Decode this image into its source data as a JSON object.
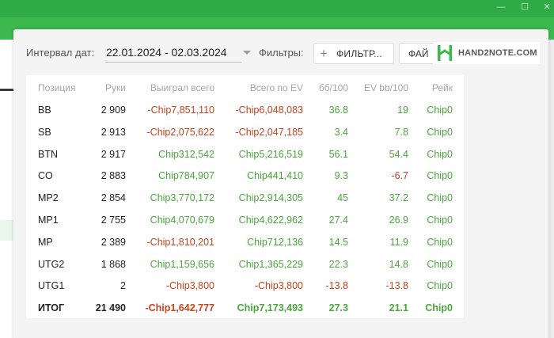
{
  "toolbar": {
    "date_label": "Интервал дат:",
    "date_range": "22.01.2024 - 02.03.2024",
    "filters_label": "Фильтры:",
    "filter_button": "ФИЛЬТР...",
    "file_button": "ФАЙ",
    "brand": "HAND2NOTE.COM"
  },
  "colors": {
    "positive": "#4aa63b",
    "negative": "#c5431e",
    "header_green": "#3cb84f"
  },
  "table": {
    "headers": [
      "Позиция",
      "Руки",
      "Выиграл всего",
      "Всего по EV",
      "бб/100",
      "EV bb/100",
      "Рейк"
    ],
    "rows": [
      {
        "pos": "BB",
        "hands": "2 909",
        "won": "-Chip7,851,110",
        "ev": "-Chip6,048,083",
        "bb": "36.8",
        "evbb": "19",
        "rake": "Chip0"
      },
      {
        "pos": "SB",
        "hands": "2 913",
        "won": "-Chip2,075,622",
        "ev": "-Chip2,047,185",
        "bb": "3.4",
        "evbb": "7.8",
        "rake": "Chip0"
      },
      {
        "pos": "BTN",
        "hands": "2 917",
        "won": "Chip312,542",
        "ev": "Chip5,216,519",
        "bb": "56.1",
        "evbb": "54.4",
        "rake": "Chip0"
      },
      {
        "pos": "CO",
        "hands": "2 883",
        "won": "Chip784,907",
        "ev": "Chip441,410",
        "bb": "9.3",
        "evbb": "-6.7",
        "rake": "Chip0"
      },
      {
        "pos": "MP2",
        "hands": "2 854",
        "won": "Chip3,770,172",
        "ev": "Chip2,914,305",
        "bb": "45",
        "evbb": "37.2",
        "rake": "Chip0"
      },
      {
        "pos": "MP1",
        "hands": "2 755",
        "won": "Chip4,070,679",
        "ev": "Chip4,622,962",
        "bb": "27.4",
        "evbb": "26.9",
        "rake": "Chip0"
      },
      {
        "pos": "MP",
        "hands": "2 389",
        "won": "-Chip1,810,201",
        "ev": "Chip712,136",
        "bb": "14.5",
        "evbb": "11.9",
        "rake": "Chip0"
      },
      {
        "pos": "UTG2",
        "hands": "1 868",
        "won": "Chip1,159,656",
        "ev": "Chip1,365,229",
        "bb": "22.3",
        "evbb": "14.8",
        "rake": "Chip0"
      },
      {
        "pos": "UTG1",
        "hands": "2",
        "won": "-Chip3,800",
        "ev": "-Chip3,800",
        "bb": "-13.8",
        "evbb": "-13.8",
        "rake": "Chip0"
      }
    ],
    "total": {
      "pos": "ИТОГ",
      "hands": "21 490",
      "won": "-Chip1,642,777",
      "ev": "Chip7,173,493",
      "bb": "27.3",
      "evbb": "21.1",
      "rake": "Chip0"
    }
  }
}
